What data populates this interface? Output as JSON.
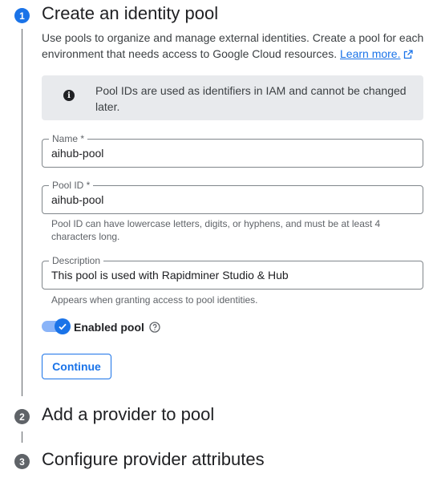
{
  "steps": [
    {
      "number": "1",
      "title": "Create an identity pool"
    },
    {
      "number": "2",
      "title": "Add a provider to pool"
    },
    {
      "number": "3",
      "title": "Configure provider attributes"
    }
  ],
  "intro": {
    "text": "Use pools to organize and manage external identities. Create a pool for each environment that needs access to Google Cloud resources.",
    "link_label": "Learn more."
  },
  "info_banner": {
    "icon": "info-icon",
    "text": "Pool IDs are used as identifiers in IAM and cannot be changed later."
  },
  "fields": {
    "name": {
      "label": "Name *",
      "value": "aihub-pool"
    },
    "pool_id": {
      "label": "Pool ID *",
      "value": "aihub-pool",
      "hint": "Pool ID can have lowercase letters, digits, or hyphens, and must be at least 4 characters long."
    },
    "description": {
      "label": "Description",
      "value": "This pool is used with Rapidminer Studio & Hub",
      "hint": "Appears when granting access to pool identities."
    }
  },
  "toggle": {
    "label": "Enabled pool",
    "enabled": true
  },
  "continue_label": "Continue",
  "colors": {
    "primary": "#1a73e8",
    "inactive_step": "#5f6368",
    "banner_bg": "#e8eaed"
  }
}
